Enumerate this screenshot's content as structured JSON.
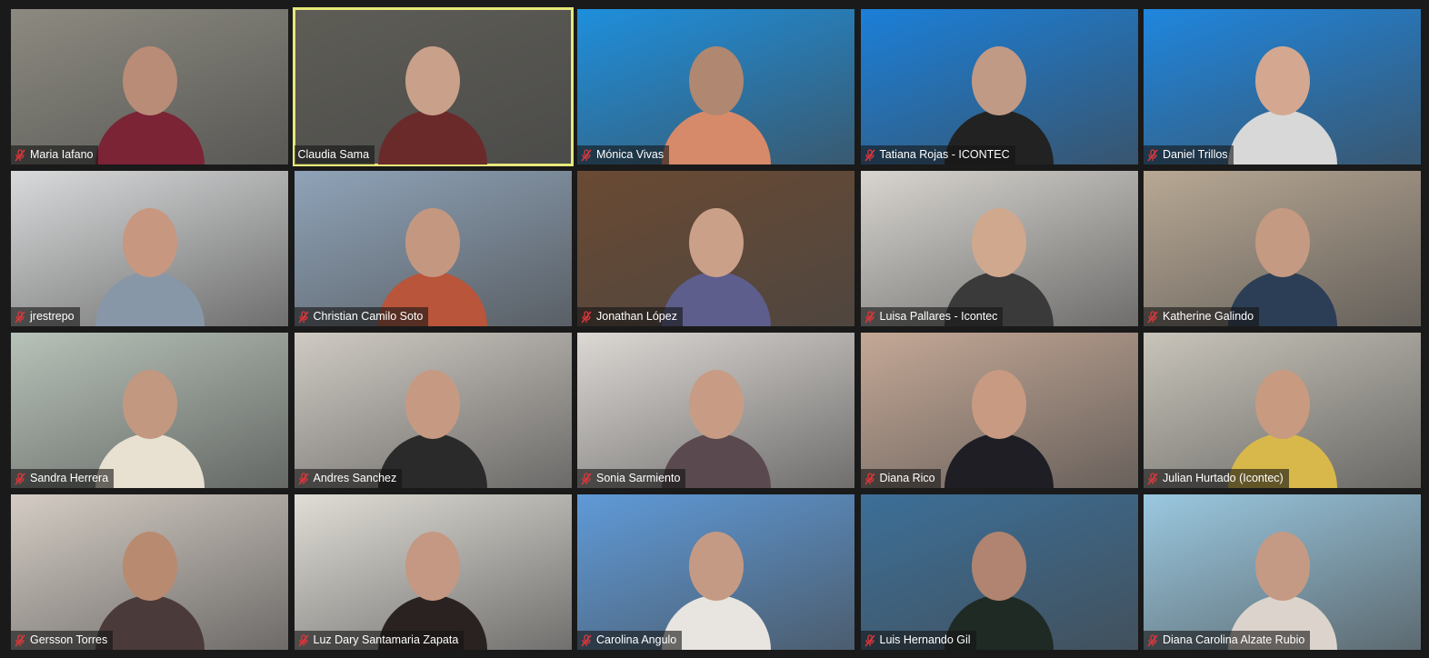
{
  "active_speaker_color": "#e6e87a",
  "muted_icon_color": "#e0363a",
  "participants": [
    {
      "name": "Maria Iafano",
      "muted": true,
      "bg": "#8c8a80",
      "skin": "#b98c78",
      "shirt": "#7a2436"
    },
    {
      "name": "Claudia Sama",
      "muted": false,
      "active": true,
      "bg": "#5e5d56",
      "skin": "#c9a08a",
      "shirt": "#6b2a2a"
    },
    {
      "name": "Mónica Vivas",
      "muted": true,
      "bg": "#1e8fdc",
      "skin": "#b08770",
      "shirt": "#d68a6a"
    },
    {
      "name": "Tatiana Rojas - ICONTEC",
      "muted": true,
      "bg": "#1b7fd8",
      "skin": "#c19a85",
      "shirt": "#222"
    },
    {
      "name": "Daniel Trillos",
      "muted": true,
      "bg": "#1f86de",
      "skin": "#d4a890",
      "shirt": "#d8d8d8"
    },
    {
      "name": "jrestrepo",
      "muted": true,
      "bg": "#d9dadb",
      "skin": "#c79780",
      "shirt": "#8797a8"
    },
    {
      "name": "Christian Camilo Soto",
      "muted": true,
      "bg": "#8fa3b8",
      "skin": "#c49880",
      "shirt": "#b8553a"
    },
    {
      "name": "Jonathan López",
      "muted": true,
      "bg": "#6a4a33",
      "skin": "#caa088",
      "shirt": "#5d5e8c"
    },
    {
      "name": "Luisa Pallares - Icontec",
      "muted": true,
      "bg": "#d8d5d0",
      "skin": "#d0a88e",
      "shirt": "#3a3a3a"
    },
    {
      "name": "Katherine Galindo",
      "muted": true,
      "bg": "#b8a894",
      "skin": "#c59a82",
      "shirt": "#2c3e55"
    },
    {
      "name": "Sandra Herrera",
      "muted": true,
      "bg": "#b7c2b8",
      "skin": "#c39880",
      "shirt": "#e8e0d0"
    },
    {
      "name": "Andres Sanchez",
      "muted": true,
      "bg": "#cfcac3",
      "skin": "#c69a82",
      "shirt": "#2a2a2a"
    },
    {
      "name": "Sonia Sarmiento",
      "muted": true,
      "bg": "#dcd8d4",
      "skin": "#c89c84",
      "shirt": "#5a4a50"
    },
    {
      "name": "Diana Rico",
      "muted": true,
      "bg": "#c4a896",
      "skin": "#c89a82",
      "shirt": "#1e1e24"
    },
    {
      "name": "Julian Hurtado (Icontec)",
      "muted": true,
      "bg": "#c8c4ba",
      "skin": "#c89a80",
      "shirt": "#d8b84a"
    },
    {
      "name": "Gersson Torres",
      "muted": true,
      "bg": "#d4ccc4",
      "skin": "#b88a70",
      "shirt": "#4a3a3a"
    },
    {
      "name": "Luz Dary Santamaria Zapata",
      "muted": true,
      "bg": "#e0ddd6",
      "skin": "#c49882",
      "shirt": "#2a2220"
    },
    {
      "name": "Carolina Angulo",
      "muted": true,
      "bg": "#5f9ad8",
      "skin": "#c49a84",
      "shirt": "#e8e4e0"
    },
    {
      "name": "Luis Hernando Gil",
      "muted": true,
      "bg": "#3c6f98",
      "skin": "#b08470",
      "shirt": "#1f2a24"
    },
    {
      "name": "Diana Carolina Alzate Rubio",
      "muted": true,
      "bg": "#9ac8e0",
      "skin": "#c49a84",
      "shirt": "#dcd4cc"
    }
  ]
}
